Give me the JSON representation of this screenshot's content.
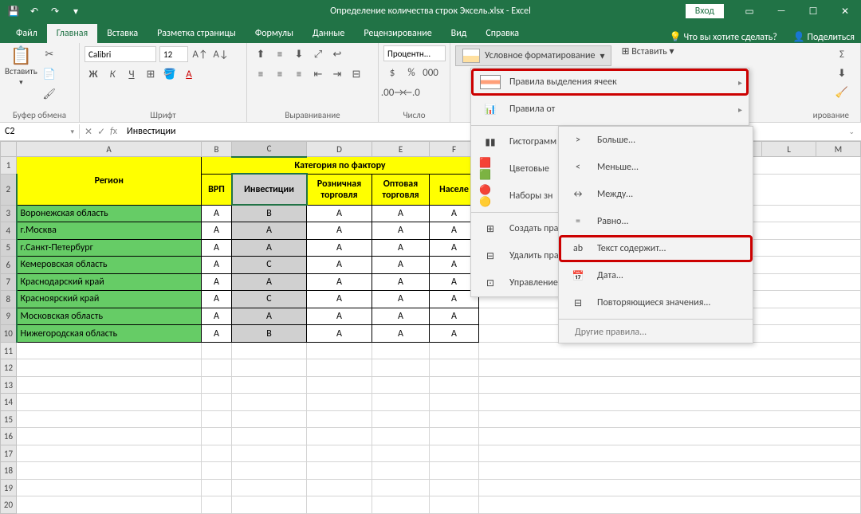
{
  "titlebar": {
    "title": "Определение количества строк Эксель.xlsx - Excel",
    "login": "Вход"
  },
  "tabs": {
    "file": "Файл",
    "home": "Главная",
    "insert": "Вставка",
    "layout": "Разметка страницы",
    "formulas": "Формулы",
    "data": "Данные",
    "review": "Рецензирование",
    "view": "Вид",
    "help": "Справка",
    "tellme": "Что вы хотите сделать?",
    "share": "Поделиться"
  },
  "ribbon": {
    "clipboard": {
      "label": "Буфер обмена",
      "paste": "Вставить"
    },
    "font": {
      "label": "Шрифт",
      "name": "Calibri",
      "size": "12"
    },
    "align": {
      "label": "Выравнивание"
    },
    "number": {
      "label": "Число",
      "format": "Процентн..."
    },
    "styles": {
      "cf": "Условное форматирование",
      "insert": "Вставить",
      "label": "ирование"
    }
  },
  "formula": {
    "cell": "C2",
    "value": "Инвестиции"
  },
  "cols": [
    "A",
    "B",
    "C",
    "D",
    "E",
    "F",
    "L",
    "M"
  ],
  "headers": {
    "merged": "Категория по фактору",
    "region": "Регион",
    "vrp": "ВРП",
    "inv": "Инвестиции",
    "retail": "Розничная торговля",
    "wholesale": "Оптовая торговля",
    "pop": "Населе"
  },
  "rows": [
    {
      "r": "Воронежская область",
      "v": [
        "A",
        "B",
        "A",
        "A",
        "A"
      ]
    },
    {
      "r": "г.Москва",
      "v": [
        "A",
        "A",
        "A",
        "A",
        "A"
      ]
    },
    {
      "r": "г.Санкт-Петербург",
      "v": [
        "A",
        "A",
        "A",
        "A",
        "A"
      ]
    },
    {
      "r": "Кемеровская область",
      "v": [
        "A",
        "C",
        "A",
        "A",
        "A"
      ]
    },
    {
      "r": "Краснодарский край",
      "v": [
        "A",
        "A",
        "A",
        "A",
        "A"
      ]
    },
    {
      "r": "Красноярский край",
      "v": [
        "A",
        "C",
        "A",
        "A",
        "A"
      ]
    },
    {
      "r": "Московская область",
      "v": [
        "A",
        "A",
        "A",
        "A",
        "A"
      ]
    },
    {
      "r": "Нижегородская область",
      "v": [
        "A",
        "B",
        "A",
        "A",
        "A"
      ]
    }
  ],
  "dd1": {
    "highlight": "Правила выделения ячеек",
    "top": "Правила от",
    "databars": "Гистограмм",
    "colorscales": "Цветовые",
    "iconsets": "Наборы зн",
    "new": "Создать прави",
    "clear": "Удалить прав",
    "manage": "Управление п"
  },
  "dd2": {
    "greater": "Больше...",
    "less": "Меньше...",
    "between": "Между...",
    "equal": "Равно...",
    "text": "Текст содержит...",
    "date": "Дата...",
    "dup": "Повторяющиеся значения...",
    "other": "Другие правила..."
  }
}
